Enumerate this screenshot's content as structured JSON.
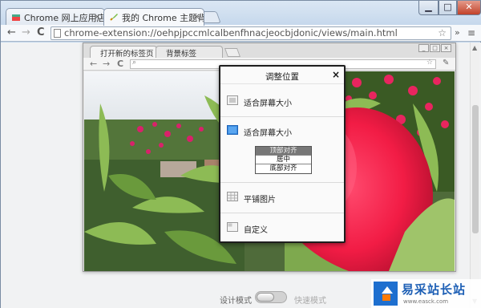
{
  "browser": {
    "tabs": [
      {
        "title": "Chrome 网上应用店 - 我",
        "active": false
      },
      {
        "title": "我的 Chrome 主题背景",
        "active": true
      }
    ],
    "window_controls": {
      "minimize": "▁",
      "maximize": "□",
      "close": "✕"
    },
    "nav": {
      "back": "←",
      "forward": "→",
      "reload": "C"
    },
    "address": "chrome-extension://oehpjpccmlcalbenfhnacjeocbjdonic/views/main.html",
    "extra_toolbar": "»",
    "menu": "≡"
  },
  "preview": {
    "tabs": [
      {
        "title": "打开新的标签页",
        "active": true
      },
      {
        "title": "背景标签",
        "active": false
      }
    ]
  },
  "dialog": {
    "title": "调整位置",
    "close": "×",
    "options": [
      {
        "label": "适合屏幕大小",
        "icon": "fit-screen-icon"
      },
      {
        "label": "适合屏幕大小",
        "icon": "fit-screen-selected-icon"
      },
      {
        "label": "平铺图片",
        "icon": "tile-icon"
      },
      {
        "label": "自定义",
        "icon": "custom-icon"
      }
    ],
    "align_options": [
      {
        "label": "顶部对齐",
        "selected": true
      },
      {
        "label": "居中",
        "selected": false
      },
      {
        "label": "底部对齐",
        "selected": false
      }
    ]
  },
  "bottom": {
    "left_label": "设计模式",
    "right_label": "快速模式",
    "toggle_on": false
  },
  "watermark": {
    "title": "易采站长站",
    "url": "www.easck.com"
  },
  "colors": {
    "accent_blue": "#1e6fcf",
    "close_red": "#c2422a",
    "selected_gray": "#777777"
  }
}
